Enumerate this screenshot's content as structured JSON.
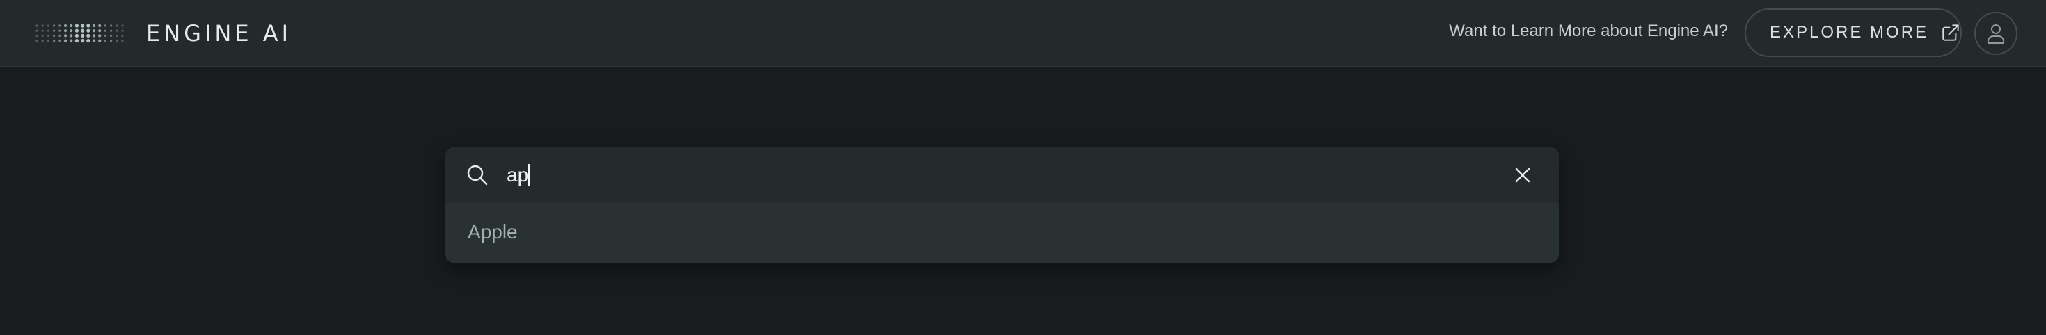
{
  "header": {
    "logo_text": "ENGINE AI",
    "promo_text": "Want to Learn More about Engine AI?",
    "explore_label": "EXPLORE MORE"
  },
  "icons": {
    "logo": "dot-grid-logo-icon",
    "explore": "external-link-icon",
    "avatar": "user-icon",
    "search": "search-icon",
    "clear": "close-icon"
  },
  "search": {
    "value": "ap",
    "placeholder": ""
  },
  "suggestions": [
    {
      "label": "Apple"
    }
  ],
  "colors": {
    "background": "#181c1d",
    "topbar": "#242a2b",
    "panel": "#252b2c",
    "suggestion_row": "#2a3132",
    "text_primary": "#f1f4f4",
    "text_muted": "#a7b0b0"
  }
}
